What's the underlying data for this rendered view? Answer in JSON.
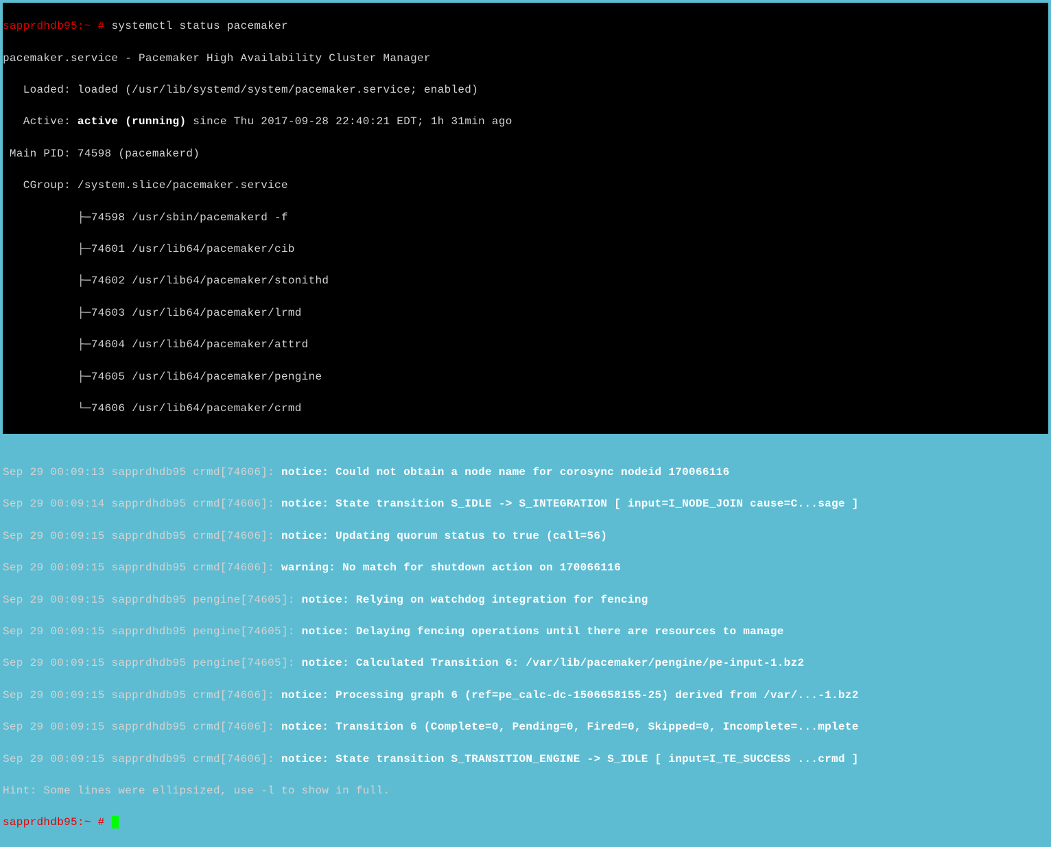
{
  "prompt1": {
    "host": "sapprdhdb95:~ # ",
    "command": "systemctl status pacemaker"
  },
  "service_line": "pacemaker.service - Pacemaker High Availability Cluster Manager",
  "loaded": "   Loaded: loaded (/usr/lib/systemd/system/pacemaker.service; enabled)",
  "active_label": "   Active: ",
  "active_status": "active (running)",
  "active_since": " since Thu 2017-09-28 22:40:21 EDT; 1h 31min ago",
  "main_pid": " Main PID: 74598 (pacemakerd)",
  "cgroup_header": "   CGroup: /system.slice/pacemaker.service",
  "cgroup": [
    "           ├─74598 /usr/sbin/pacemakerd -f",
    "           ├─74601 /usr/lib64/pacemaker/cib",
    "           ├─74602 /usr/lib64/pacemaker/stonithd",
    "           ├─74603 /usr/lib64/pacemaker/lrmd",
    "           ├─74604 /usr/lib64/pacemaker/attrd",
    "           ├─74605 /usr/lib64/pacemaker/pengine",
    "           └─74606 /usr/lib64/pacemaker/crmd"
  ],
  "blank": " ",
  "logs": [
    {
      "pre": "Sep 29 00:09:13 sapprdhdb95 crmd[74606]: ",
      "bold": "notice: Could not obtain a node name for corosync nodeid 170066116"
    },
    {
      "pre": "Sep 29 00:09:14 sapprdhdb95 crmd[74606]: ",
      "bold": "notice: State transition S_IDLE -> S_INTEGRATION [ input=I_NODE_JOIN cause=C...sage ]"
    },
    {
      "pre": "Sep 29 00:09:15 sapprdhdb95 crmd[74606]: ",
      "bold": "notice: Updating quorum status to true (call=56)"
    },
    {
      "pre": "Sep 29 00:09:15 sapprdhdb95 crmd[74606]: ",
      "bold": "warning: No match for shutdown action on 170066116"
    },
    {
      "pre": "Sep 29 00:09:15 sapprdhdb95 pengine[74605]: ",
      "bold": "notice: Relying on watchdog integration for fencing"
    },
    {
      "pre": "Sep 29 00:09:15 sapprdhdb95 pengine[74605]: ",
      "bold": "notice: Delaying fencing operations until there are resources to manage"
    },
    {
      "pre": "Sep 29 00:09:15 sapprdhdb95 pengine[74605]: ",
      "bold": "notice: Calculated Transition 6: /var/lib/pacemaker/pengine/pe-input-1.bz2"
    },
    {
      "pre": "Sep 29 00:09:15 sapprdhdb95 crmd[74606]: ",
      "bold": "notice: Processing graph 6 (ref=pe_calc-dc-1506658155-25) derived from /var/...-1.bz2"
    },
    {
      "pre": "Sep 29 00:09:15 sapprdhdb95 crmd[74606]: ",
      "bold": "notice: Transition 6 (Complete=0, Pending=0, Fired=0, Skipped=0, Incomplete=...mplete"
    },
    {
      "pre": "Sep 29 00:09:15 sapprdhdb95 crmd[74606]: ",
      "bold": "notice: State transition S_TRANSITION_ENGINE -> S_IDLE [ input=I_TE_SUCCESS ...crmd ]"
    }
  ],
  "hint": "Hint: Some lines were ellipsized, use -l to show in full.",
  "prompt2": {
    "host": "sapprdhdb95:~ # "
  }
}
